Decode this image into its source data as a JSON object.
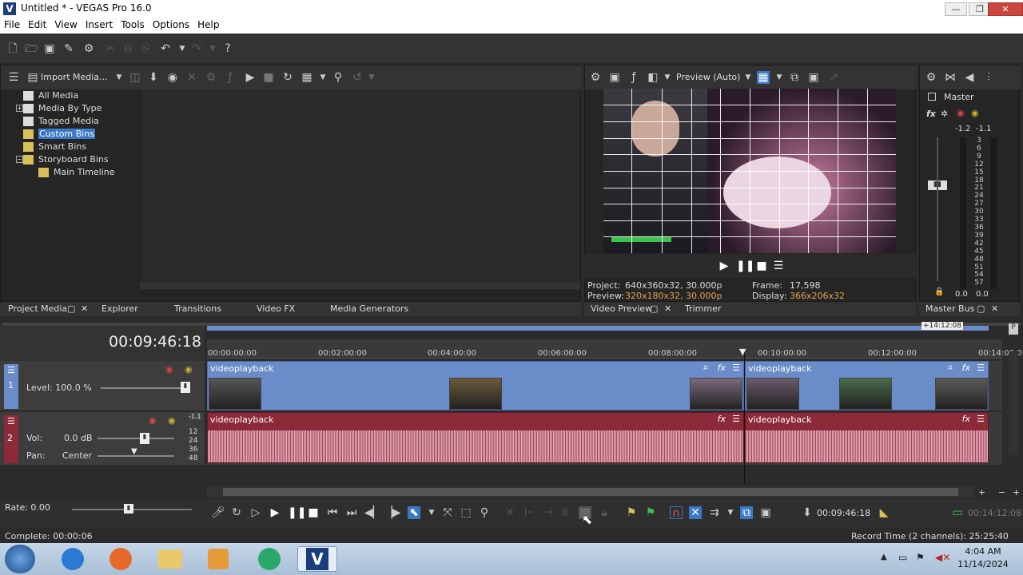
{
  "window": {
    "title": "Untitled * - VEGAS Pro 16.0",
    "app_icon": "V",
    "controls": [
      "—",
      "❐",
      "✕"
    ]
  },
  "menu": [
    "File",
    "Edit",
    "View",
    "Insert",
    "Tools",
    "Options",
    "Help"
  ],
  "media_toolbar": {
    "import_label": "Import Media..."
  },
  "project_tree": [
    "All Media",
    "Media By Type",
    "Tagged Media",
    "Custom Bins",
    "Smart Bins",
    "Storyboard Bins",
    "Main Timeline"
  ],
  "left_tabs": {
    "project_media": "Project Media",
    "explorer": "Explorer",
    "transitions": "Transitions",
    "video_fx": "Video FX",
    "media_generators": "Media Generators"
  },
  "preview": {
    "quality": "Preview (Auto)",
    "project_label": "Project:",
    "project_value": "640x360x32, 30.000p",
    "preview_label": "Preview:",
    "preview_value": "320x180x32, 30.000p",
    "frame_label": "Frame:",
    "frame_value": "17,598",
    "display_label": "Display:",
    "display_value": "366x206x32",
    "tab_video_preview": "Video Preview",
    "tab_trimmer": "Trimmer"
  },
  "master": {
    "label": "Master",
    "left_peak": "-1.2",
    "right_peak": "-1.1",
    "scale": [
      "3",
      "6",
      "9",
      "12",
      "15",
      "18",
      "21",
      "24",
      "27",
      "30",
      "33",
      "36",
      "39",
      "42",
      "45",
      "48",
      "51",
      "54",
      "57"
    ],
    "bottom_left": "0.0",
    "bottom_right": "0.0",
    "tab": "Master Bus"
  },
  "timeline": {
    "timecode": "00:09:46:18",
    "end_marker": "+14:12:08",
    "ruler": [
      "00:00:00:00",
      "00:02:00:00",
      "00:04:00:00",
      "00:06:00:00",
      "00:08:00:00",
      "00:10:00:00",
      "00:12:00:00",
      "00:14:00:0"
    ],
    "video_track": {
      "number": "1",
      "level": "Level: 100.0 %"
    },
    "audio_track": {
      "number": "2",
      "vol_label": "Vol:",
      "vol_value": "0.0 dB",
      "pan_label": "Pan:",
      "pan_value": "Center",
      "peak": "-1.1",
      "scale": [
        "12",
        "24",
        "36",
        "48"
      ]
    },
    "clip_name": "videoplayback"
  },
  "transport": {
    "rate": "Rate: 0.00",
    "cursor_time": "00:09:46:18",
    "length": "00:14:12:08"
  },
  "status": {
    "complete": "Complete: 00:00:06",
    "record_time": "Record Time (2 channels): 25:25:40"
  },
  "taskbar": {
    "time": "4:04 AM",
    "date": "11/14/2024"
  }
}
